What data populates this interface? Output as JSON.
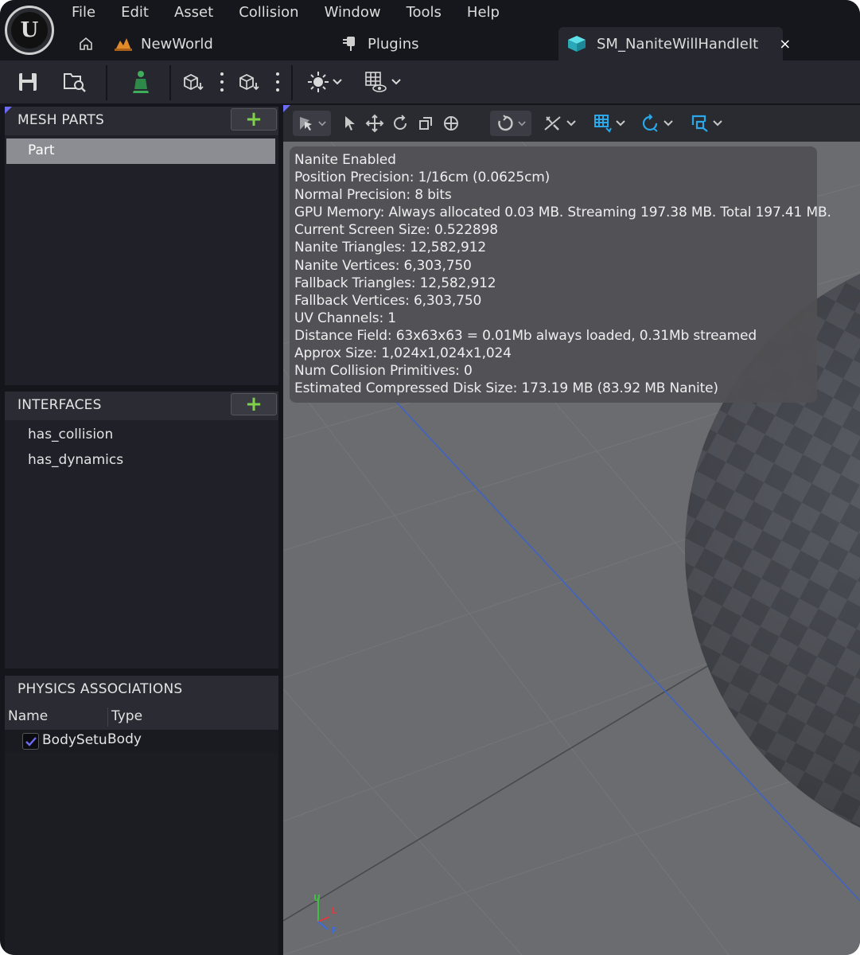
{
  "menu": [
    "File",
    "Edit",
    "Asset",
    "Collision",
    "Window",
    "Tools",
    "Help"
  ],
  "tabs": {
    "world": "NewWorld",
    "plugins": "Plugins",
    "active": "SM_NaniteWillHandleIt",
    "close": "×"
  },
  "logo_text": "U",
  "icons": {
    "home": "home-icon",
    "world": "level-icon",
    "plugins": "plug-icon",
    "mesh": "static-mesh-icon",
    "save": "save-icon",
    "browse": "browse-icon",
    "bone": "mesh-icon"
  },
  "panels": {
    "mesh_parts": {
      "title": "MESH PARTS",
      "add": "+",
      "items": [
        "Part"
      ]
    },
    "interfaces": {
      "title": "INTERFACES",
      "add": "+",
      "items": [
        "has_collision",
        "has_dynamics"
      ]
    },
    "physics": {
      "title": "PHYSICS ASSOCIATIONS",
      "col_name": "Name",
      "col_type": "Type",
      "row_name": "BodySetup",
      "row_type": "Body",
      "checked": true
    }
  },
  "info_lines": [
    "Nanite Enabled",
    "Position Precision: 1/16cm (0.0625cm)",
    "Normal Precision: 8 bits",
    "GPU Memory: Always allocated 0.03 MB. Streaming 197.38 MB. Total 197.41 MB.",
    "Current Screen Size:  0.522898",
    "Nanite Triangles:  12,582,912",
    "Nanite Vertices:  6,303,750",
    "Fallback Triangles:  12,582,912",
    "Fallback Vertices:  6,303,750",
    "UV Channels:  1",
    "Distance Field:  63x63x63 = 0.01Mb always loaded, 0.31Mb streamed",
    "Approx Size: 1,024x1,024x1,024",
    "Num Collision Primitives:  0",
    "Estimated Compressed Disk Size: 173.19 MB (83.92 MB Nanite)"
  ],
  "axis": {
    "up": "U",
    "left": "L",
    "forward": "F"
  },
  "colors": {
    "accent_green": "#7fd14a",
    "accent_blue": "#2aa8e8",
    "selection": "#8c8d92",
    "panel_bg": "#1f2028"
  }
}
